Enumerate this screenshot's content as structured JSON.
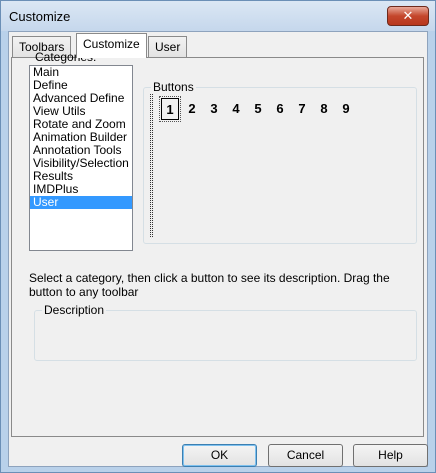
{
  "window": {
    "title": "Customize",
    "close_glyph": "✕"
  },
  "tabs": [
    {
      "label": "Toolbars"
    },
    {
      "label": "Customize"
    },
    {
      "label": "User"
    }
  ],
  "categories": {
    "label": "Categories:",
    "items": [
      "Main",
      "Define",
      "Advanced Define",
      "View Utils",
      "Rotate and Zoom",
      "Animation Builder",
      "Annotation Tools",
      "Visibility/Selection",
      "Results",
      "IMDPlus",
      "User"
    ],
    "selected": "User"
  },
  "buttons_group": {
    "title": "Buttons",
    "items": [
      "1",
      "2",
      "3",
      "4",
      "5",
      "6",
      "7",
      "8",
      "9"
    ]
  },
  "instructions": "Select a category, then click a button to see its description. Drag the button to any toolbar",
  "description_group": {
    "title": "Description"
  },
  "footer": {
    "ok": "OK",
    "cancel": "Cancel",
    "help": "Help"
  },
  "colors": {
    "selection": "#3399ff",
    "titlebar": "#c5d7ec",
    "close": "#c4462c"
  }
}
